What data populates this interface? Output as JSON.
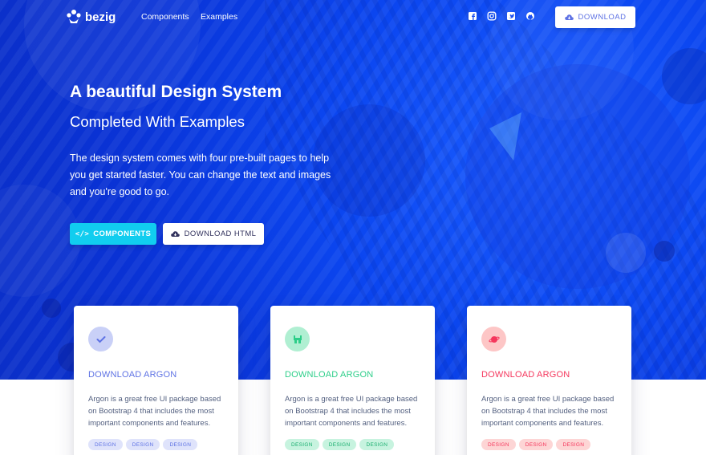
{
  "navbar": {
    "brand": "bezig",
    "links": [
      "Components",
      "Examples"
    ],
    "social_icons": [
      "facebook-icon",
      "instagram-icon",
      "twitter-icon",
      "github-icon"
    ],
    "download_label": "DOWNLOAD"
  },
  "hero": {
    "title": "A beautiful Design System",
    "subtitle": "Completed With Examples",
    "lead": "The design system comes with four pre-built pages to help you get started faster. You can change the text and images and you're good to go.",
    "components_button": "COMPONENTS",
    "download_html_button": "DOWNLOAD HTML"
  },
  "cards": [
    {
      "icon": "check-icon",
      "title": "DOWNLOAD ARGON",
      "description": "Argon is a great free UI package based on Bootstrap 4 that includes the most important components and features.",
      "tags": [
        "DESIGN",
        "DESIGN",
        "DESIGN"
      ],
      "accent": "#5e72e4",
      "circle_bg": "#c9d0f7",
      "tag_bg": "#dfe3fb",
      "tag_color": "#5e72e4"
    },
    {
      "icon": "istanbul-icon",
      "title": "DOWNLOAD ARGON",
      "description": "Argon is a great free UI package based on Bootstrap 4 that includes the most important components and features.",
      "tags": [
        "DESIGN",
        "DESIGN",
        "DESIGN"
      ],
      "accent": "#2dce89",
      "circle_bg": "#b0efd2",
      "tag_bg": "#c7f3df",
      "tag_color": "#1aae6f"
    },
    {
      "icon": "planet-icon",
      "title": "DOWNLOAD ARGON",
      "description": "Argon is a great free UI package based on Bootstrap 4 that includes the most important components and features.",
      "tags": [
        "DESIGN",
        "DESIGN",
        "DESIGN"
      ],
      "accent": "#f5365c",
      "circle_bg": "#fdc6c6",
      "tag_bg": "#fdd5d5",
      "tag_color": "#f5365c"
    }
  ],
  "colors": {
    "primary": "#5e72e4",
    "info": "#11cdef",
    "hero_blue": "#0b46f0"
  }
}
